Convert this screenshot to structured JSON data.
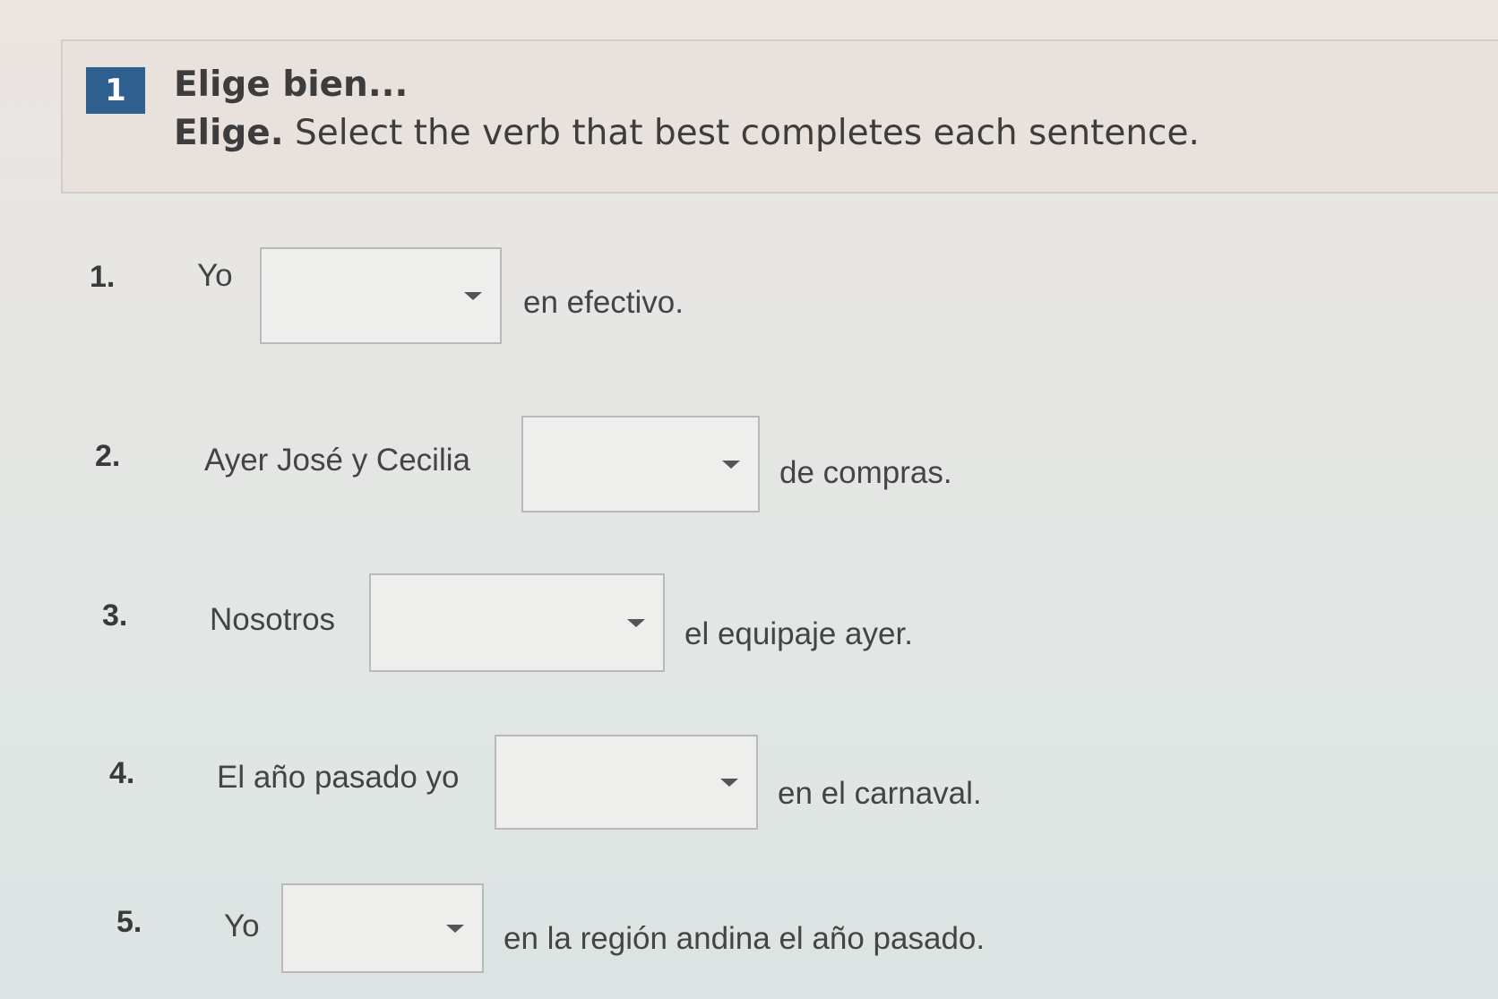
{
  "exercise": {
    "number": "1",
    "title": "Elige bien...",
    "instruction_bold": "Elige.",
    "instruction_rest": " Select the verb that best completes each sentence."
  },
  "questions": [
    {
      "number": "1.",
      "before": "Yo",
      "selected": "",
      "after": "en efectivo."
    },
    {
      "number": "2.",
      "before": "Ayer José y Cecilia",
      "selected": "",
      "after": "de compras."
    },
    {
      "number": "3.",
      "before": "Nosotros",
      "selected": "",
      "after": "el equipaje ayer."
    },
    {
      "number": "4.",
      "before": "El año pasado yo",
      "selected": "",
      "after": "en el carnaval."
    },
    {
      "number": "5.",
      "before": "Yo",
      "selected": "",
      "after": "en la región andina el año pasado."
    }
  ],
  "icons": {
    "dropdown": "chevron-down-icon"
  },
  "colors": {
    "badge": "#2e5f8e"
  }
}
